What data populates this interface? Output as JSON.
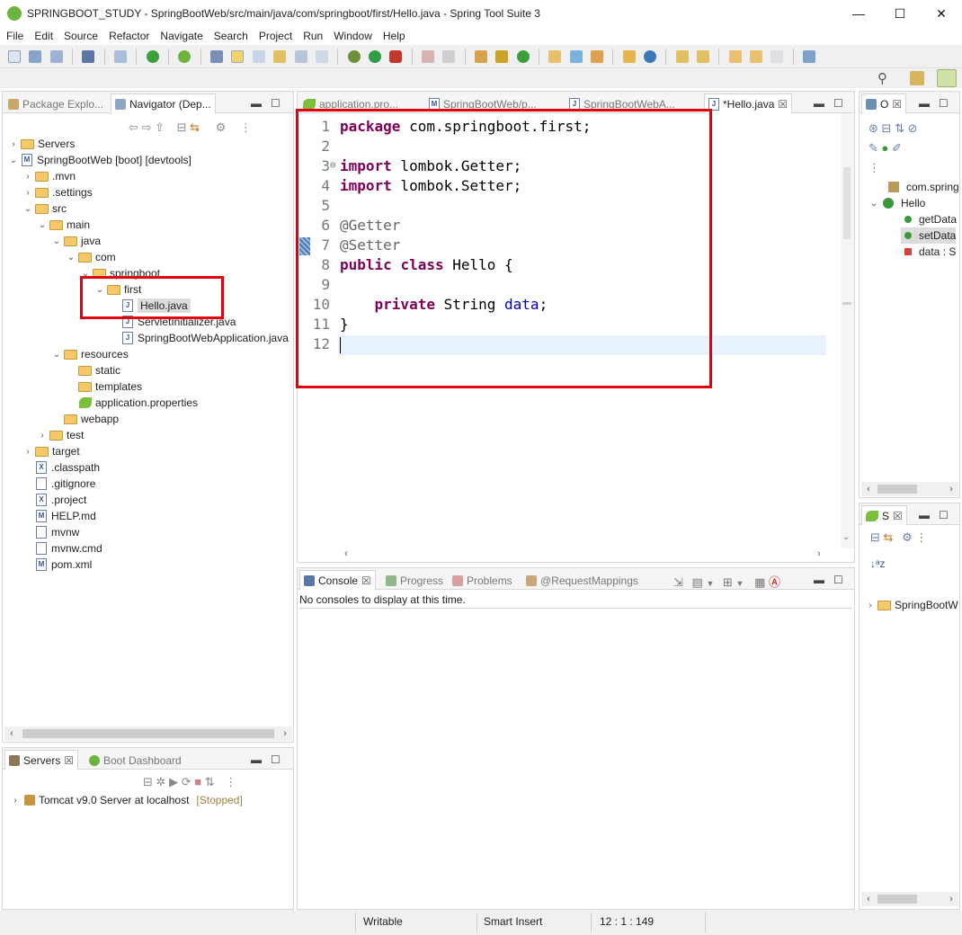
{
  "window": {
    "title": "SPRINGBOOT_STUDY - SpringBootWeb/src/main/java/com/springboot/first/Hello.java - Spring Tool Suite 3",
    "minimize": "—",
    "maximize": "☐",
    "close": "✕"
  },
  "menu": [
    "File",
    "Edit",
    "Source",
    "Refactor",
    "Navigate",
    "Search",
    "Project",
    "Run",
    "Window",
    "Help"
  ],
  "left_pane": {
    "tabs": [
      "Package Explo...",
      "Navigator (Dep..."
    ],
    "tree": [
      {
        "label": "Servers",
        "type": "folder",
        "depth": 0,
        "chev": ">"
      },
      {
        "label": "SpringBootWeb [boot] [devtools]",
        "type": "project",
        "depth": 0,
        "chev": "v"
      },
      {
        "label": ".mvn",
        "type": "folder",
        "depth": 1,
        "chev": ">"
      },
      {
        "label": ".settings",
        "type": "folder",
        "depth": 1,
        "chev": ">"
      },
      {
        "label": "src",
        "type": "folder",
        "depth": 1,
        "chev": "v"
      },
      {
        "label": "main",
        "type": "folder",
        "depth": 2,
        "chev": "v"
      },
      {
        "label": "java",
        "type": "folder",
        "depth": 3,
        "chev": "v"
      },
      {
        "label": "com",
        "type": "folder",
        "depth": 4,
        "chev": "v"
      },
      {
        "label": "springboot",
        "type": "folder",
        "depth": 5,
        "chev": "v"
      },
      {
        "label": "first",
        "type": "folder",
        "depth": 6,
        "chev": "v"
      },
      {
        "label": "Hello.java",
        "type": "java",
        "depth": 7,
        "chev": "",
        "selected": true
      },
      {
        "label": "ServletInitializer.java",
        "type": "java",
        "depth": 7,
        "chev": ""
      },
      {
        "label": "SpringBootWebApplication.java",
        "type": "java",
        "depth": 7,
        "chev": ""
      },
      {
        "label": "resources",
        "type": "folder",
        "depth": 3,
        "chev": "v"
      },
      {
        "label": "static",
        "type": "folder",
        "depth": 4,
        "chev": ""
      },
      {
        "label": "templates",
        "type": "folder",
        "depth": 4,
        "chev": ""
      },
      {
        "label": "application.properties",
        "type": "leaf",
        "depth": 4,
        "chev": ""
      },
      {
        "label": "webapp",
        "type": "folder",
        "depth": 3,
        "chev": ""
      },
      {
        "label": "test",
        "type": "folder",
        "depth": 2,
        "chev": ">"
      },
      {
        "label": "target",
        "type": "folder",
        "depth": 1,
        "chev": ">"
      },
      {
        "label": ".classpath",
        "type": "xfile",
        "depth": 1,
        "chev": ""
      },
      {
        "label": ".gitignore",
        "type": "file",
        "depth": 1,
        "chev": ""
      },
      {
        "label": ".project",
        "type": "xfile",
        "depth": 1,
        "chev": ""
      },
      {
        "label": "HELP.md",
        "type": "mfile",
        "depth": 1,
        "chev": ""
      },
      {
        "label": "mvnw",
        "type": "file",
        "depth": 1,
        "chev": ""
      },
      {
        "label": "mvnw.cmd",
        "type": "file",
        "depth": 1,
        "chev": ""
      },
      {
        "label": "pom.xml",
        "type": "mfile",
        "depth": 1,
        "chev": ""
      }
    ]
  },
  "servers_pane": {
    "tabs": [
      "Servers",
      "Boot Dashboard"
    ],
    "server_name": "Tomcat v9.0 Server at localhost",
    "server_status": "[Stopped]"
  },
  "editor": {
    "tabs": [
      "application.pro...",
      "SpringBootWeb/p...",
      "SpringBootWebA...",
      "*Hello.java"
    ],
    "lines": [
      {
        "n": "1",
        "tokens": [
          {
            "t": "package",
            "c": "kw"
          },
          {
            "t": " com.springboot.first;",
            "c": ""
          }
        ]
      },
      {
        "n": "2",
        "tokens": []
      },
      {
        "n": "3",
        "tokens": [
          {
            "t": "import",
            "c": "kw"
          },
          {
            "t": " lombok.Getter;",
            "c": ""
          }
        ],
        "fold": "⊖"
      },
      {
        "n": "4",
        "tokens": [
          {
            "t": "import",
            "c": "kw"
          },
          {
            "t": " lombok.Setter;",
            "c": ""
          }
        ]
      },
      {
        "n": "5",
        "tokens": []
      },
      {
        "n": "6",
        "tokens": [
          {
            "t": "@Getter",
            "c": "ann"
          }
        ]
      },
      {
        "n": "7",
        "tokens": [
          {
            "t": "@Setter",
            "c": "ann"
          }
        ],
        "marker": true
      },
      {
        "n": "8",
        "tokens": [
          {
            "t": "public",
            "c": "kw"
          },
          {
            "t": " ",
            "c": ""
          },
          {
            "t": "class",
            "c": "kw"
          },
          {
            "t": " Hello {",
            "c": ""
          }
        ]
      },
      {
        "n": "9",
        "tokens": []
      },
      {
        "n": "10",
        "tokens": [
          {
            "t": "    ",
            "c": ""
          },
          {
            "t": "private",
            "c": "kw"
          },
          {
            "t": " String ",
            "c": ""
          },
          {
            "t": "data",
            "c": "fld"
          },
          {
            "t": ";",
            "c": ""
          }
        ]
      },
      {
        "n": "11",
        "tokens": [
          {
            "t": "}",
            "c": ""
          }
        ]
      },
      {
        "n": "12",
        "tokens": []
      }
    ]
  },
  "outline_pane": {
    "tab": "O",
    "items": [
      {
        "label": "com.spring",
        "type": "package"
      },
      {
        "label": "Hello",
        "type": "class"
      },
      {
        "label": "getData",
        "type": "method"
      },
      {
        "label": "setData",
        "type": "method"
      },
      {
        "label": "data : S",
        "type": "field"
      }
    ]
  },
  "spring_pane": {
    "tab": "S",
    "item": "SpringBootW"
  },
  "console_pane": {
    "tabs": [
      "Console",
      "Progress",
      "Problems",
      "@RequestMappings"
    ],
    "message": "No consoles to display at this time."
  },
  "status": {
    "writable": "Writable",
    "insert_mode": "Smart Insert",
    "position": "12 : 1 : 149"
  },
  "colors": {
    "highlight": "#e00010",
    "keyword": "#7f0055",
    "annotation": "#646464",
    "field": "#0000c0",
    "current_line": "#e8f2fe"
  }
}
